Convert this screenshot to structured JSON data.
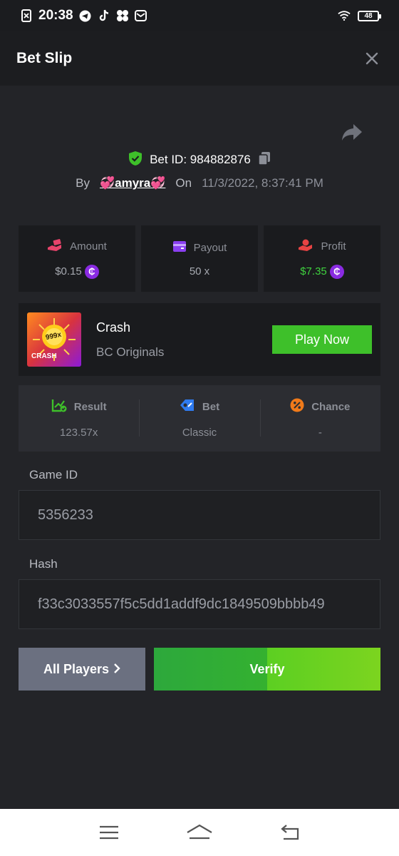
{
  "status_bar": {
    "time": "20:38",
    "battery": "48"
  },
  "header": {
    "title": "Bet Slip"
  },
  "bet": {
    "bet_id_label": "Bet ID:",
    "bet_id": "984882876",
    "by_label": "By",
    "username": "💞amyra💞",
    "on_label": "On",
    "date": "11/3/2022, 8:37:41 PM"
  },
  "stats": [
    {
      "label": "Amount",
      "value": "$0.15",
      "icon": "hand-money-icon",
      "color": "#e8436b"
    },
    {
      "label": "Payout",
      "value": "50 x",
      "icon": "wallet-icon",
      "color": "#8a3ff0"
    },
    {
      "label": "Profit",
      "value": "$7.35",
      "icon": "hand-coin-icon",
      "color": "#e84343"
    }
  ],
  "coin_symbol": "₵",
  "game": {
    "name": "Crash",
    "provider": "BC Originals",
    "thumb_text": "CRASH",
    "thumb_badge": "999x",
    "play_label": "Play Now"
  },
  "details": [
    {
      "label": "Result",
      "value": "123.57x",
      "icon": "chart-check-icon",
      "color": "#3ec02a"
    },
    {
      "label": "Bet",
      "value": "Classic",
      "icon": "tag-icon",
      "color": "#2f7bf0"
    },
    {
      "label": "Chance",
      "value": "-",
      "icon": "percent-icon",
      "color": "#f07a1a"
    }
  ],
  "game_id": {
    "label": "Game ID",
    "value": "5356233"
  },
  "hash": {
    "label": "Hash",
    "value": "f33c3033557f5c5dd1addf9dc1849509bbbb49"
  },
  "buttons": {
    "all_players": "All Players",
    "verify": "Verify"
  },
  "colors": {
    "background": "#232428",
    "accent_green": "#3ec02a",
    "profit_green": "#3fd23f",
    "coin_purple": "#8a2be2"
  }
}
